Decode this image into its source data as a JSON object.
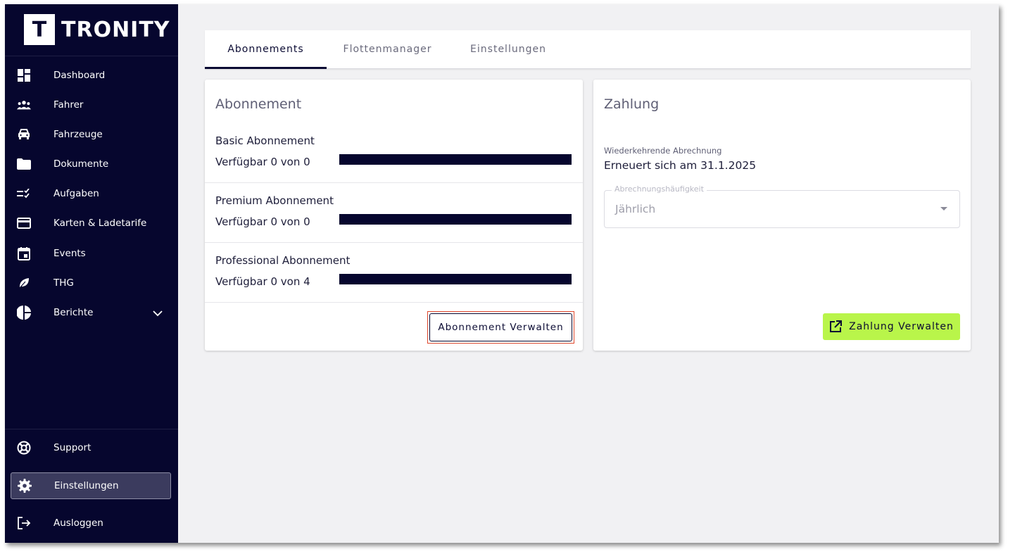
{
  "brand": {
    "logo_letter": "T",
    "name": "TRONITY"
  },
  "sidebar": {
    "items": [
      {
        "label": "Dashboard",
        "icon": "dashboard-icon"
      },
      {
        "label": "Fahrer",
        "icon": "drivers-icon"
      },
      {
        "label": "Fahrzeuge",
        "icon": "car-icon"
      },
      {
        "label": "Dokumente",
        "icon": "folder-icon"
      },
      {
        "label": "Aufgaben",
        "icon": "tasks-icon"
      },
      {
        "label": "Karten & Ladetarife",
        "icon": "card-icon"
      },
      {
        "label": "Events",
        "icon": "calendar-icon"
      },
      {
        "label": "THG",
        "icon": "leaf-icon"
      },
      {
        "label": "Berichte",
        "icon": "pie-chart-icon"
      }
    ],
    "bottom_items": [
      {
        "label": "Support",
        "icon": "lifebuoy-icon"
      },
      {
        "label": "Einstellungen",
        "icon": "gear-icon",
        "active": true
      },
      {
        "label": "Ausloggen",
        "icon": "logout-icon"
      }
    ]
  },
  "tabs": [
    {
      "label": "Abonnements",
      "active": true
    },
    {
      "label": "Flottenmanager"
    },
    {
      "label": "Einstellungen"
    }
  ],
  "subscription_card": {
    "title": "Abonnement",
    "rows": [
      {
        "name": "Basic Abonnement",
        "available": "Verfügbar 0 von 0"
      },
      {
        "name": "Premium Abonnement",
        "available": "Verfügbar 0 von 0"
      },
      {
        "name": "Professional Abonnement",
        "available": "Verfügbar 0 von 4"
      }
    ],
    "manage_button": "Abonnement Verwalten"
  },
  "payment_card": {
    "title": "Zahlung",
    "recurring_label": "Wiederkehrende Abrechnung",
    "renewal_text": "Erneuert sich am 31.1.2025",
    "frequency_label": "Abrechnungshäufigkeit",
    "frequency_value": "Jährlich",
    "manage_button": "Zahlung Verwalten"
  },
  "colors": {
    "sidebar_bg": "#06062e",
    "accent_green": "#b9f54a",
    "highlight_red": "#e0472c"
  }
}
